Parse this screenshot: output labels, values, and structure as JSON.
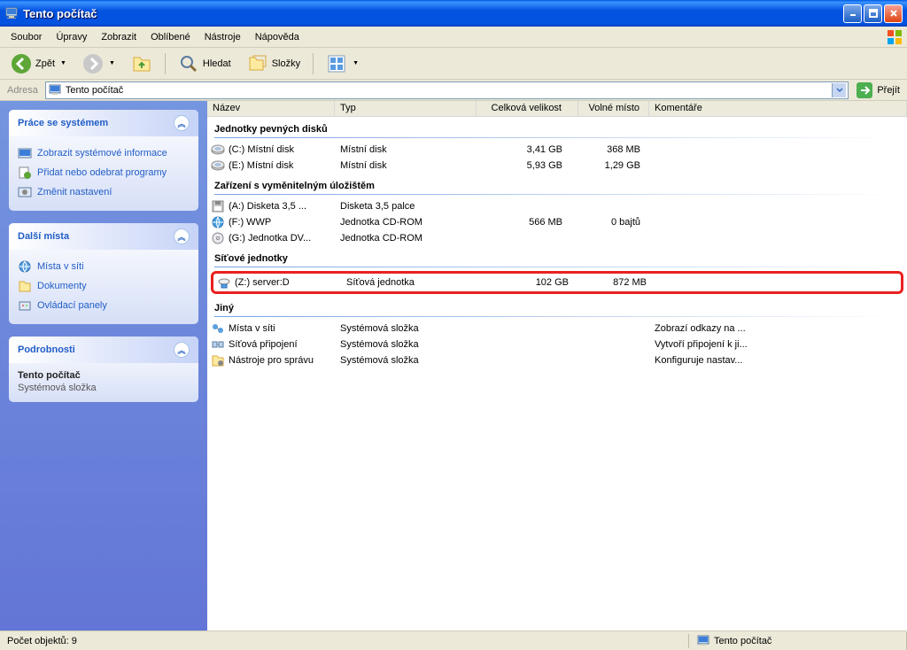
{
  "window": {
    "title": "Tento počítač"
  },
  "menu": [
    "Soubor",
    "Úpravy",
    "Zobrazit",
    "Oblíbené",
    "Nástroje",
    "Nápověda"
  ],
  "toolbar": {
    "back": "Zpět",
    "search": "Hledat",
    "folders": "Složky"
  },
  "address": {
    "label": "Adresa",
    "value": "Tento počítač",
    "go": "Přejít"
  },
  "sidebar": {
    "box1": {
      "title": "Práce se systémem",
      "links": [
        {
          "label": "Zobrazit systémové informace"
        },
        {
          "label": "Přidat nebo odebrat programy"
        },
        {
          "label": "Změnit nastavení"
        }
      ]
    },
    "box2": {
      "title": "Další místa",
      "links": [
        {
          "label": "Místa v síti"
        },
        {
          "label": "Dokumenty"
        },
        {
          "label": "Ovládací panely"
        }
      ]
    },
    "box3": {
      "title": "Podrobnosti",
      "name": "Tento počítač",
      "type": "Systémová složka"
    }
  },
  "columns": {
    "name": "Název",
    "type": "Typ",
    "size": "Celková velikost",
    "free": "Volné místo",
    "comment": "Komentáře"
  },
  "groups": {
    "g1": {
      "title": "Jednotky pevných disků",
      "rows": [
        {
          "name": "(C:) Místní disk",
          "type": "Místní disk",
          "size": "3,41 GB",
          "free": "368 MB",
          "comment": ""
        },
        {
          "name": "(E:) Místní disk",
          "type": "Místní disk",
          "size": "5,93 GB",
          "free": "1,29 GB",
          "comment": ""
        }
      ]
    },
    "g2": {
      "title": "Zařízení s vyměnitelným úložištěm",
      "rows": [
        {
          "name": "(A:) Disketa 3,5 ...",
          "type": "Disketa 3,5 palce",
          "size": "",
          "free": "",
          "comment": ""
        },
        {
          "name": "(F:) WWP",
          "type": "Jednotka CD-ROM",
          "size": "566 MB",
          "free": "0 bajtů",
          "comment": ""
        },
        {
          "name": "(G:) Jednotka DV...",
          "type": "Jednotka CD-ROM",
          "size": "",
          "free": "",
          "comment": ""
        }
      ]
    },
    "g3": {
      "title": "Síťové jednotky",
      "rows": [
        {
          "name": "(Z:) server:D",
          "type": "Síťová jednotka",
          "size": "102 GB",
          "free": "872 MB",
          "comment": "",
          "hl": true
        }
      ]
    },
    "g4": {
      "title": "Jiný",
      "rows": [
        {
          "name": "Místa v síti",
          "type": "Systémová složka",
          "size": "",
          "free": "",
          "comment": "Zobrazí odkazy na ..."
        },
        {
          "name": "Síťová připojení",
          "type": "Systémová složka",
          "size": "",
          "free": "",
          "comment": "Vytvoří připojení k ji..."
        },
        {
          "name": "Nástroje pro správu",
          "type": "Systémová složka",
          "size": "",
          "free": "",
          "comment": "Konfiguruje nastav..."
        }
      ]
    }
  },
  "status": {
    "count_label": "Počet objektů: 9",
    "right": "Tento počítač"
  }
}
